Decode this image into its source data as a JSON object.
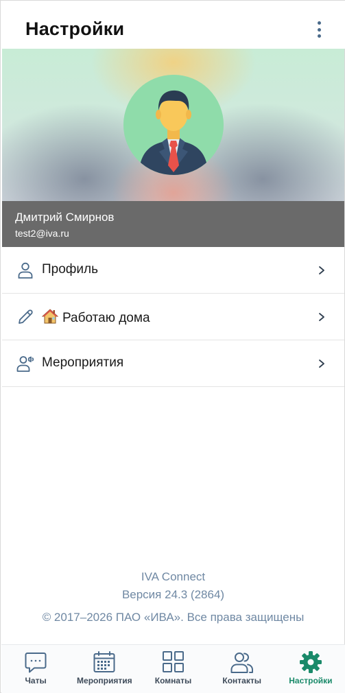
{
  "header": {
    "title": "Настройки",
    "menu_icon": "more-vertical-icon"
  },
  "profile": {
    "avatar_icon": "businessman-avatar",
    "name": "Дмитрий Смирнов",
    "email": "test2@iva.ru"
  },
  "menu": {
    "items": [
      {
        "icon": "person-icon",
        "label": "Профиль"
      },
      {
        "icon": "pencil-icon",
        "emoji_icon": "house-emoji",
        "label": "Работаю дома"
      },
      {
        "icon": "events-icon",
        "label": "Мероприятия"
      }
    ]
  },
  "about": {
    "app_name": "IVA Connect",
    "version": "Версия 24.3 (2864)",
    "copyright": "© 2017–2026 ПАО «ИВА». Все права защищены"
  },
  "bottom_nav": {
    "items": [
      {
        "icon": "chat-icon",
        "label": "Чаты",
        "active": false
      },
      {
        "icon": "calendar-icon",
        "label": "Мероприятия",
        "active": false
      },
      {
        "icon": "rooms-icon",
        "label": "Комнаты",
        "active": false
      },
      {
        "icon": "contacts-icon",
        "label": "Контакты",
        "active": false
      },
      {
        "icon": "gear-icon",
        "label": "Настройки",
        "active": true
      }
    ]
  },
  "colors": {
    "accent": "#1a8a6a",
    "icon_blue": "#4a6a8a",
    "user_band": "#6a6a6a",
    "about_text": "#6f88a3"
  }
}
